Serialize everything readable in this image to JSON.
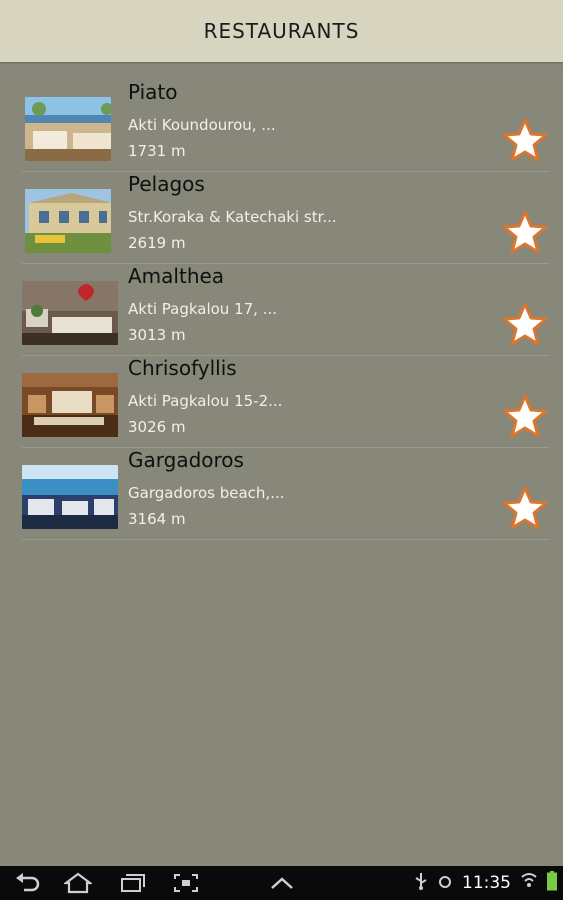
{
  "header": {
    "title": "RESTAURANTS"
  },
  "restaurants": [
    {
      "name": "Piato",
      "address": "Akti Koundourou, ...",
      "distance": "1731 m",
      "favorite_icon": "star-outline-icon"
    },
    {
      "name": "Pelagos",
      "address": "Str.Koraka & Katechaki str...",
      "distance": "2619 m",
      "favorite_icon": "star-outline-icon"
    },
    {
      "name": "Amalthea",
      "address": "Akti Pagkalou 17, ...",
      "distance": "3013 m",
      "favorite_icon": "star-outline-icon"
    },
    {
      "name": "Chrisofyllis",
      "address": "Akti Pagkalou 15-2...",
      "distance": "3026 m",
      "favorite_icon": "star-outline-icon"
    },
    {
      "name": "Gargadoros",
      "address": "Gargadoros beach,...",
      "distance": "3164 m",
      "favorite_icon": "star-outline-icon"
    }
  ],
  "statusbar": {
    "time": "11:35",
    "icons": [
      "back-icon",
      "home-icon",
      "recent-apps-icon",
      "screenshot-icon",
      "up-chevron-icon",
      "usb-icon",
      "sync-icon",
      "wifi-icon",
      "battery-icon"
    ]
  },
  "colors": {
    "background": "#87877a",
    "header": "#d7d4bf",
    "star_fill": "#ffffff",
    "star_stroke": "#d9772f"
  }
}
